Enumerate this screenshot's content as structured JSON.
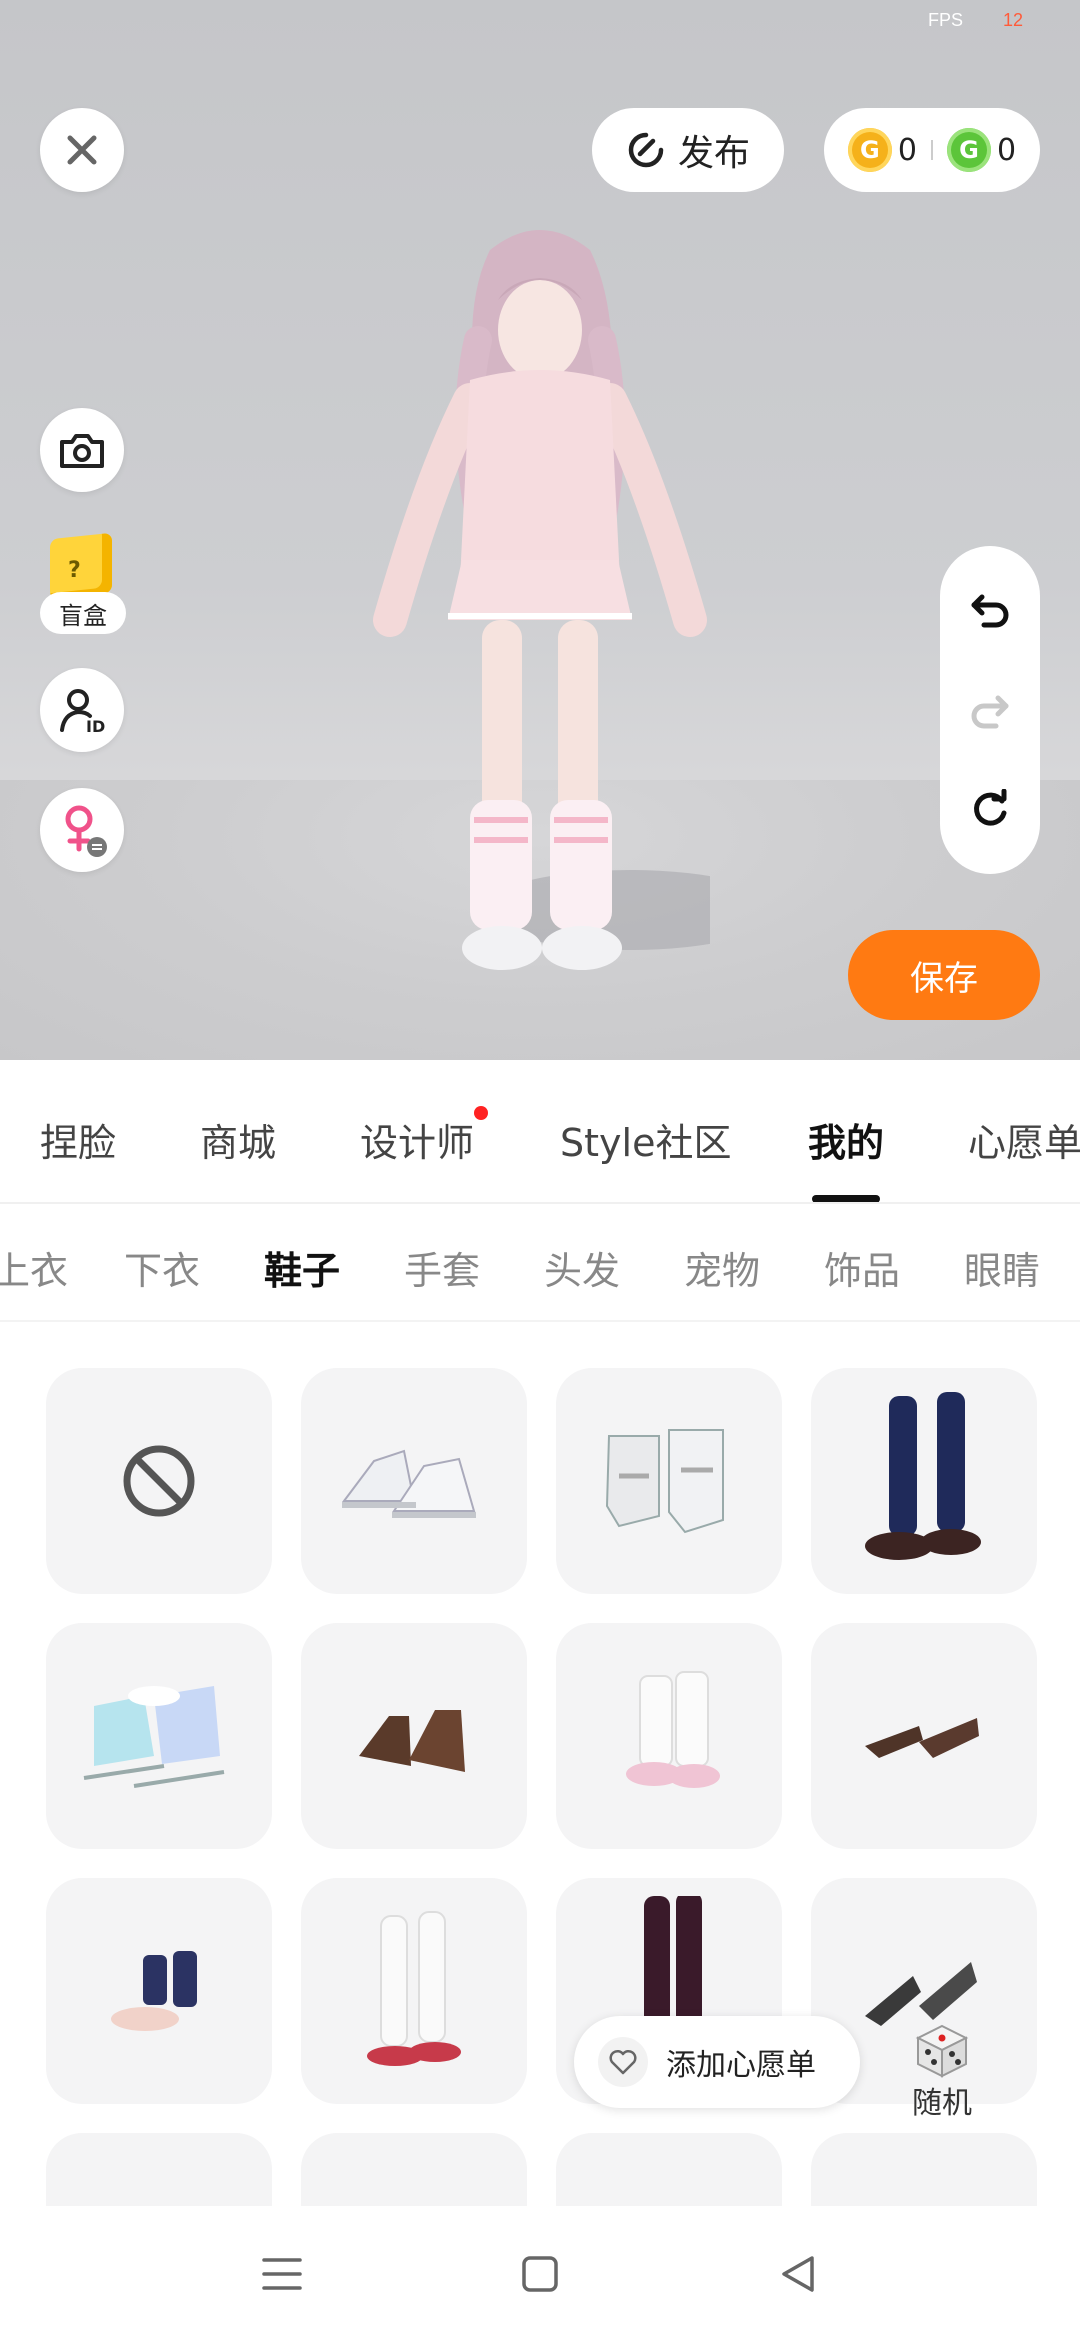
{
  "status": {
    "fps_label": "FPS",
    "fps_value": "12"
  },
  "toolbar": {
    "publish_label": "发布",
    "gold_coins": "0",
    "green_coins": "0"
  },
  "left_tools": {
    "blindbox_label": "盲盒"
  },
  "save_label": "保存",
  "main_tabs": [
    {
      "label": "捏脸"
    },
    {
      "label": "商城"
    },
    {
      "label": "设计师"
    },
    {
      "label": "Style社区"
    },
    {
      "label": "我的"
    },
    {
      "label": "心愿单"
    }
  ],
  "active_main_tab": "我的",
  "sub_tabs": [
    {
      "label": "上衣"
    },
    {
      "label": "下衣"
    },
    {
      "label": "鞋子"
    },
    {
      "label": "手套"
    },
    {
      "label": "头发"
    },
    {
      "label": "宠物"
    },
    {
      "label": "饰品"
    },
    {
      "label": "眼睛"
    }
  ],
  "active_sub_tab": "鞋子",
  "items": [
    {
      "icon": "none-icon"
    },
    {
      "icon": "white-sneakers-icon"
    },
    {
      "icon": "white-boots-icon"
    },
    {
      "icon": "navy-socks-loafers-icon"
    },
    {
      "icon": "ice-skates-icon"
    },
    {
      "icon": "brown-ankle-shoes-icon"
    },
    {
      "icon": "white-pink-boots-icon"
    },
    {
      "icon": "brown-heels-icon"
    },
    {
      "icon": "navy-ankle-socks-icon"
    },
    {
      "icon": "white-tall-socks-icon"
    },
    {
      "icon": "burgundy-socks-icon"
    },
    {
      "icon": "black-heels-icon"
    }
  ],
  "floating": {
    "wishlist_label": "添加心愿单",
    "random_label": "随机"
  },
  "colors": {
    "accent": "#ff7a12",
    "tab_indicator": "#111111",
    "notification": "#ff2222"
  }
}
